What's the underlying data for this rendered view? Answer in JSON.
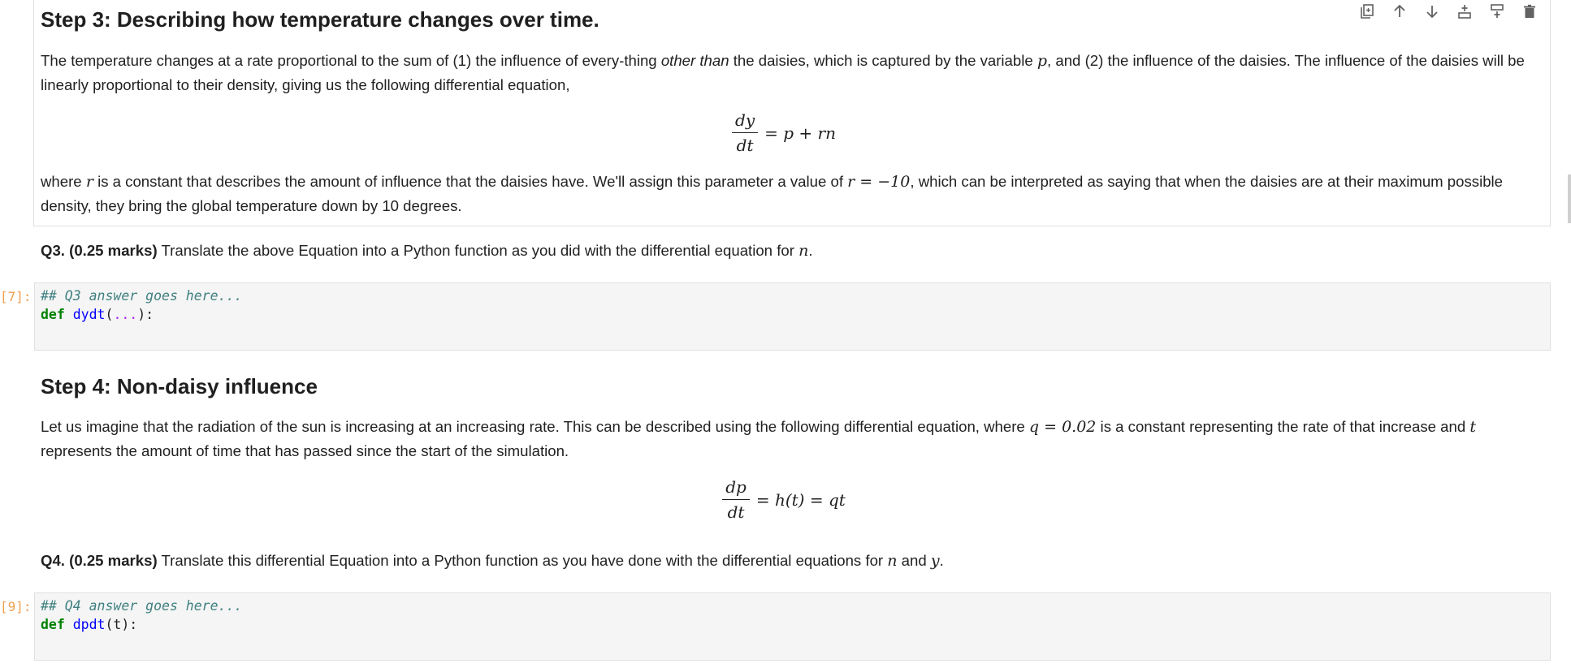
{
  "step3": {
    "heading": "Step 3: Describing how temperature changes over time.",
    "para1_a": "The temperature changes at a rate proportional to the sum of (1) the influence of every-thing ",
    "para1_em": "other than",
    "para1_b": " the daisies, which is captured by the variable ",
    "para1_var": "p",
    "para1_c": ", and (2) the influence of the daisies. The influence of the daisies will be linearly proportional to their density, giving us the following differential equation,",
    "eq_num": "dy",
    "eq_den": "dt",
    "eq_rest": "= p + rn",
    "para2_a": "where ",
    "para2_var": "r",
    "para2_b": " is a constant that describes the amount of influence that the daisies have. We'll assign this parameter a value of ",
    "para2_math": "r = −10",
    "para2_c": ", which can be interpreted as saying that when the daisies are at their maximum possible density, they bring the global temperature down by 10 degrees."
  },
  "q3": {
    "label": "Q3. (0.25 marks)",
    "text": " Translate the above Equation into a Python function as you did with the differential equation for ",
    "var": "n",
    "end": "."
  },
  "code3": {
    "prompt": "[7]:",
    "comment": "## Q3 answer goes here...",
    "kw": "def",
    "fn": "dydt",
    "open": "(",
    "args": "...",
    "close": "):"
  },
  "step4": {
    "heading": "Step 4: Non-daisy influence",
    "para1_a": "Let us imagine that the radiation of the sun is increasing at an increasing rate. This can be described using the following differential equation, where ",
    "para1_math": "q = 0.02",
    "para1_b": " is a constant representing the rate of that increase and ",
    "para1_var": "t",
    "para1_c": " represents the amount of time that has passed since the start of the simulation.",
    "eq_num": "dp",
    "eq_den": "dt",
    "eq_rest": "= h(t) = qt"
  },
  "q4": {
    "label": "Q4. (0.25 marks)",
    "text": " Translate this differential Equation into a Python function as you have done with the differential equations for ",
    "var1": "n",
    "mid": " and ",
    "var2": "y",
    "end": "."
  },
  "code4": {
    "prompt": "[9]:",
    "comment": "## Q4 answer goes here...",
    "kw": "def",
    "fn": "dpdt",
    "args": "(t):"
  },
  "toolbar": {
    "icons": [
      "duplicate-icon",
      "move-up-icon",
      "move-down-icon",
      "insert-above-icon",
      "insert-below-icon",
      "delete-icon"
    ]
  }
}
